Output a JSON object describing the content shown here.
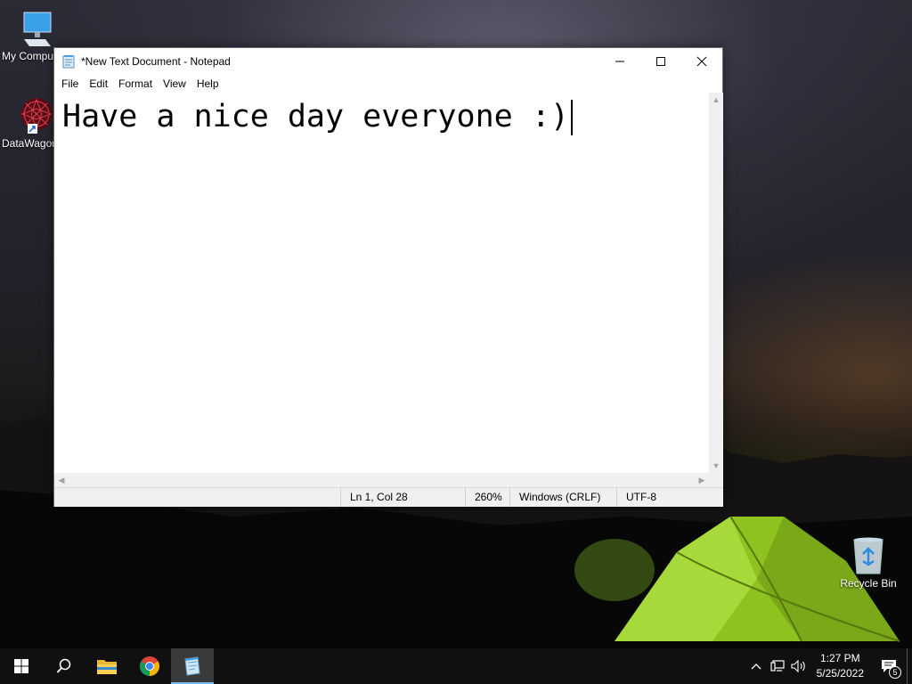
{
  "desktop": {
    "icons": [
      {
        "label": "My Computer",
        "icon": "computer-icon"
      },
      {
        "label": "DataWagon",
        "icon": "datawagon-icon"
      },
      {
        "label": "Recycle Bin",
        "icon": "recycle-bin-icon"
      }
    ]
  },
  "notepad": {
    "title": "*New Text Document - Notepad",
    "menu": [
      "File",
      "Edit",
      "Format",
      "View",
      "Help"
    ],
    "content": "Have a nice day everyone :)",
    "status": {
      "position": "Ln 1, Col 28",
      "zoom": "260%",
      "line_ending": "Windows (CRLF)",
      "encoding": "UTF-8"
    }
  },
  "taskbar": {
    "apps": [
      {
        "name": "start",
        "icon": "windows-start-icon"
      },
      {
        "name": "search",
        "icon": "search-icon"
      },
      {
        "name": "file-explorer",
        "icon": "folder-icon"
      },
      {
        "name": "chrome",
        "icon": "chrome-icon"
      },
      {
        "name": "notepad",
        "icon": "notepad-icon",
        "active": true
      }
    ],
    "clock": {
      "time": "1:27 PM",
      "date": "5/25/2022"
    },
    "notification_count": "5"
  },
  "colors": {
    "taskbar_bg": "#101010",
    "active_indicator": "#76b9ed",
    "tent_green": "#9fd22a"
  }
}
